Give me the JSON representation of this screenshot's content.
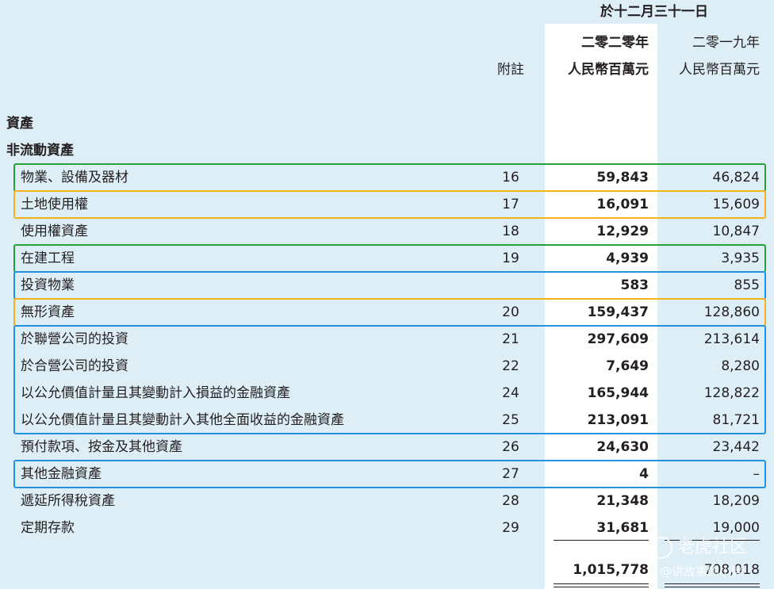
{
  "header": {
    "period": "於十二月三十一日",
    "note_label": "附註",
    "col2020_year": "二零二零年",
    "col2020_unit": "人民幣百萬元",
    "col2019_year": "二零一九年",
    "col2019_unit": "人民幣百萬元"
  },
  "section": {
    "assets": "資產",
    "non_current": "非流動資產"
  },
  "rows": [
    {
      "label": "物業、設備及器材",
      "note": "16",
      "y2020": "59,843",
      "y2019": "46,824"
    },
    {
      "label": "土地使用權",
      "note": "17",
      "y2020": "16,091",
      "y2019": "15,609"
    },
    {
      "label": "使用權資產",
      "note": "18",
      "y2020": "12,929",
      "y2019": "10,847"
    },
    {
      "label": "在建工程",
      "note": "19",
      "y2020": "4,939",
      "y2019": "3,935"
    },
    {
      "label": "投資物業",
      "note": "",
      "y2020": "583",
      "y2019": "855"
    },
    {
      "label": "無形資產",
      "note": "20",
      "y2020": "159,437",
      "y2019": "128,860"
    },
    {
      "label": "於聯營公司的投資",
      "note": "21",
      "y2020": "297,609",
      "y2019": "213,614"
    },
    {
      "label": "於合營公司的投資",
      "note": "22",
      "y2020": "7,649",
      "y2019": "8,280"
    },
    {
      "label": "以公允價值計量且其變動計入損益的金融資產",
      "note": "24",
      "y2020": "165,944",
      "y2019": "128,822"
    },
    {
      "label": "以公允價值計量且其變動計入其他全面收益的金融資產",
      "note": "25",
      "y2020": "213,091",
      "y2019": "81,721"
    },
    {
      "label": "預付款項、按金及其他資產",
      "note": "26",
      "y2020": "24,630",
      "y2019": "23,442"
    },
    {
      "label": "其他金融資產",
      "note": "27",
      "y2020": "4",
      "y2019": "–"
    },
    {
      "label": "遞延所得稅資產",
      "note": "28",
      "y2020": "21,348",
      "y2019": "18,209"
    },
    {
      "label": "定期存款",
      "note": "29",
      "y2020": "31,681",
      "y2019": "19,000"
    }
  ],
  "total": {
    "y2020": "1,015,778",
    "y2019": "708,018"
  },
  "highlight_colors": {
    "green": "#23a23a",
    "orange": "#f5b21b",
    "blue": "#1f93dd"
  },
  "watermark": {
    "brand": "老虎社区",
    "handle": "@讲故事的小胖"
  }
}
